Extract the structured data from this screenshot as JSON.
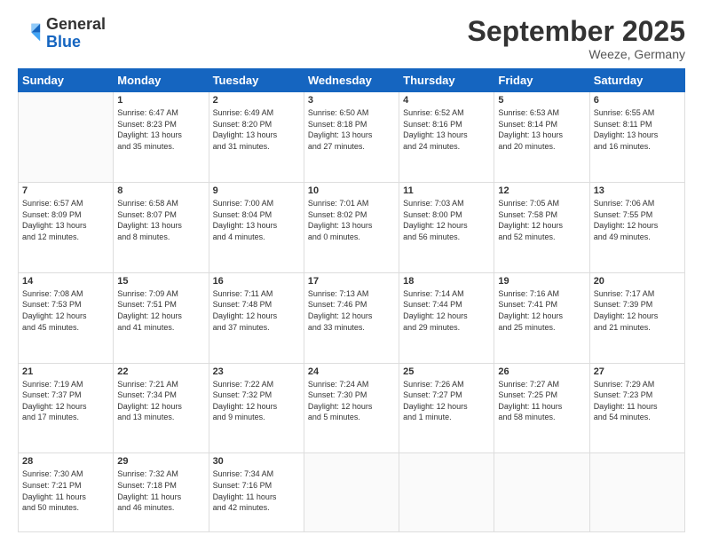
{
  "header": {
    "logo_general": "General",
    "logo_blue": "Blue",
    "month_title": "September 2025",
    "location": "Weeze, Germany"
  },
  "weekdays": [
    "Sunday",
    "Monday",
    "Tuesday",
    "Wednesday",
    "Thursday",
    "Friday",
    "Saturday"
  ],
  "weeks": [
    [
      {
        "day": "",
        "info": ""
      },
      {
        "day": "1",
        "info": "Sunrise: 6:47 AM\nSunset: 8:23 PM\nDaylight: 13 hours\nand 35 minutes."
      },
      {
        "day": "2",
        "info": "Sunrise: 6:49 AM\nSunset: 8:20 PM\nDaylight: 13 hours\nand 31 minutes."
      },
      {
        "day": "3",
        "info": "Sunrise: 6:50 AM\nSunset: 8:18 PM\nDaylight: 13 hours\nand 27 minutes."
      },
      {
        "day": "4",
        "info": "Sunrise: 6:52 AM\nSunset: 8:16 PM\nDaylight: 13 hours\nand 24 minutes."
      },
      {
        "day": "5",
        "info": "Sunrise: 6:53 AM\nSunset: 8:14 PM\nDaylight: 13 hours\nand 20 minutes."
      },
      {
        "day": "6",
        "info": "Sunrise: 6:55 AM\nSunset: 8:11 PM\nDaylight: 13 hours\nand 16 minutes."
      }
    ],
    [
      {
        "day": "7",
        "info": "Sunrise: 6:57 AM\nSunset: 8:09 PM\nDaylight: 13 hours\nand 12 minutes."
      },
      {
        "day": "8",
        "info": "Sunrise: 6:58 AM\nSunset: 8:07 PM\nDaylight: 13 hours\nand 8 minutes."
      },
      {
        "day": "9",
        "info": "Sunrise: 7:00 AM\nSunset: 8:04 PM\nDaylight: 13 hours\nand 4 minutes."
      },
      {
        "day": "10",
        "info": "Sunrise: 7:01 AM\nSunset: 8:02 PM\nDaylight: 13 hours\nand 0 minutes."
      },
      {
        "day": "11",
        "info": "Sunrise: 7:03 AM\nSunset: 8:00 PM\nDaylight: 12 hours\nand 56 minutes."
      },
      {
        "day": "12",
        "info": "Sunrise: 7:05 AM\nSunset: 7:58 PM\nDaylight: 12 hours\nand 52 minutes."
      },
      {
        "day": "13",
        "info": "Sunrise: 7:06 AM\nSunset: 7:55 PM\nDaylight: 12 hours\nand 49 minutes."
      }
    ],
    [
      {
        "day": "14",
        "info": "Sunrise: 7:08 AM\nSunset: 7:53 PM\nDaylight: 12 hours\nand 45 minutes."
      },
      {
        "day": "15",
        "info": "Sunrise: 7:09 AM\nSunset: 7:51 PM\nDaylight: 12 hours\nand 41 minutes."
      },
      {
        "day": "16",
        "info": "Sunrise: 7:11 AM\nSunset: 7:48 PM\nDaylight: 12 hours\nand 37 minutes."
      },
      {
        "day": "17",
        "info": "Sunrise: 7:13 AM\nSunset: 7:46 PM\nDaylight: 12 hours\nand 33 minutes."
      },
      {
        "day": "18",
        "info": "Sunrise: 7:14 AM\nSunset: 7:44 PM\nDaylight: 12 hours\nand 29 minutes."
      },
      {
        "day": "19",
        "info": "Sunrise: 7:16 AM\nSunset: 7:41 PM\nDaylight: 12 hours\nand 25 minutes."
      },
      {
        "day": "20",
        "info": "Sunrise: 7:17 AM\nSunset: 7:39 PM\nDaylight: 12 hours\nand 21 minutes."
      }
    ],
    [
      {
        "day": "21",
        "info": "Sunrise: 7:19 AM\nSunset: 7:37 PM\nDaylight: 12 hours\nand 17 minutes."
      },
      {
        "day": "22",
        "info": "Sunrise: 7:21 AM\nSunset: 7:34 PM\nDaylight: 12 hours\nand 13 minutes."
      },
      {
        "day": "23",
        "info": "Sunrise: 7:22 AM\nSunset: 7:32 PM\nDaylight: 12 hours\nand 9 minutes."
      },
      {
        "day": "24",
        "info": "Sunrise: 7:24 AM\nSunset: 7:30 PM\nDaylight: 12 hours\nand 5 minutes."
      },
      {
        "day": "25",
        "info": "Sunrise: 7:26 AM\nSunset: 7:27 PM\nDaylight: 12 hours\nand 1 minute."
      },
      {
        "day": "26",
        "info": "Sunrise: 7:27 AM\nSunset: 7:25 PM\nDaylight: 11 hours\nand 58 minutes."
      },
      {
        "day": "27",
        "info": "Sunrise: 7:29 AM\nSunset: 7:23 PM\nDaylight: 11 hours\nand 54 minutes."
      }
    ],
    [
      {
        "day": "28",
        "info": "Sunrise: 7:30 AM\nSunset: 7:21 PM\nDaylight: 11 hours\nand 50 minutes."
      },
      {
        "day": "29",
        "info": "Sunrise: 7:32 AM\nSunset: 7:18 PM\nDaylight: 11 hours\nand 46 minutes."
      },
      {
        "day": "30",
        "info": "Sunrise: 7:34 AM\nSunset: 7:16 PM\nDaylight: 11 hours\nand 42 minutes."
      },
      {
        "day": "",
        "info": ""
      },
      {
        "day": "",
        "info": ""
      },
      {
        "day": "",
        "info": ""
      },
      {
        "day": "",
        "info": ""
      }
    ]
  ]
}
